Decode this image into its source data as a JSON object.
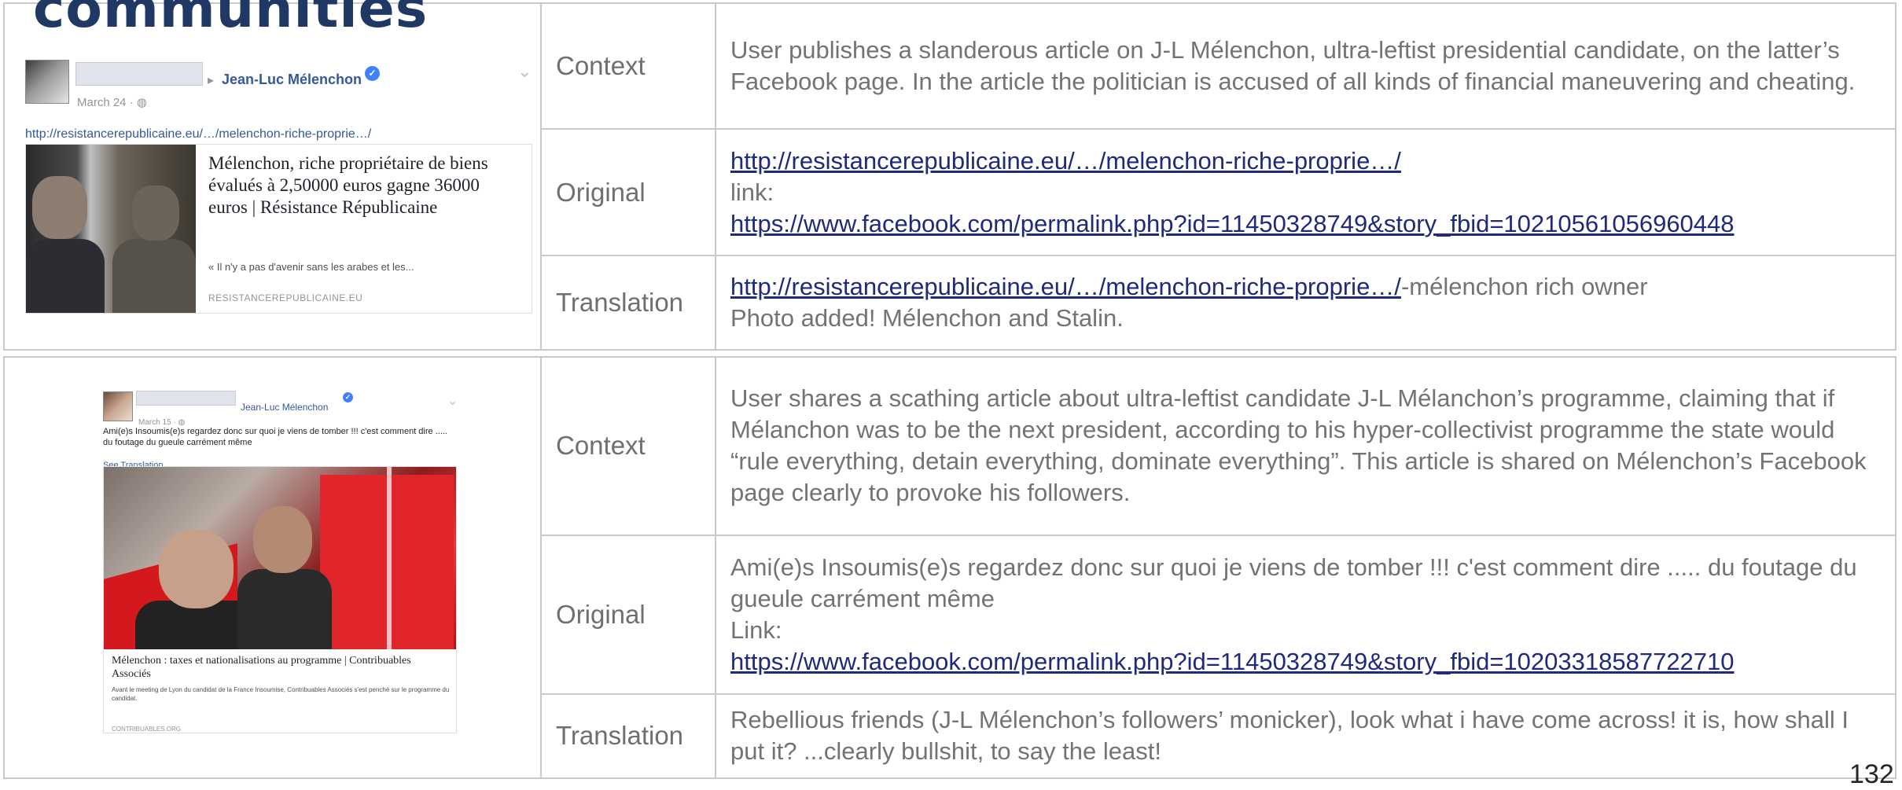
{
  "slide": {
    "heading": "communities",
    "page_number": "132"
  },
  "labels": {
    "context": "Context",
    "original": "Original",
    "translation": "Translation"
  },
  "entry1": {
    "fb": {
      "name": "Jean-Luc Mélenchon",
      "date": "March 24 · ",
      "url": "http://resistancerepublicaine.eu/…/melenchon-riche-proprie…/",
      "card_title": "Mélenchon, riche propriétaire de biens évalués à 2,50000 euros gagne 36000 euros | Résistance Républicaine",
      "card_desc": "« Il n'y a pas d'avenir sans les arabes et les...",
      "card_source": "RESISTANCEREPUBLICAINE.EU"
    },
    "context": "User publishes a slanderous article on J-L Mélenchon, ultra-leftist presidential candidate, on the latter’s Facebook page. In the article the politician is accused of all kinds of financial maneuvering and cheating.",
    "original_link1": "http://resistancerepublicaine.eu/…/melenchon-riche-proprie…/",
    "original_link_label": "link:",
    "original_link2": "https://www.facebook.com/permalink.php?id=11450328749&story_fbid=10210561056960448",
    "translation_link": "http://resistancerepublicaine.eu/…/melenchon-riche-proprie…/",
    "translation_suffix": "-mélenchon rich owner",
    "translation_line2": "Photo added! Mélenchon and Stalin."
  },
  "entry2": {
    "fb": {
      "name": "Jean-Luc Mélenchon",
      "date": "March 15 · ",
      "post_text": "Ami(e)s Insoumis(e)s regardez donc sur quoi je viens de tomber !!! c'est comment dire ..... du foutage du gueule carrément même",
      "see_translation": "See Translation",
      "card_title": "Mélenchon : taxes et nationalisations au programme | Contribuables Associés",
      "card_desc": "Avant le meeting de Lyon du candidat de la France Insoumise, Contribuables Associés s'est penché sur le programme du candidat.",
      "card_source": "CONTRIBUABLES.ORG"
    },
    "context": "User shares a scathing article about ultra-leftist candidate J-L Mélanchon’s programme, claiming that if Mélanchon was to be the next president, according to his hyper-collectivist programme the state would “rule everything, detain everything, dominate everything”. This article is shared on Mélenchon’s Facebook page clearly to provoke his followers.",
    "original_text": "Ami(e)s Insoumis(e)s regardez donc sur quoi je viens de tomber !!! c'est comment dire ..... du foutage du gueule carrément même",
    "original_link_label": "Link:",
    "original_link": "https://www.facebook.com/permalink.php?id=11450328749&story_fbid=10203318587722710",
    "translation": "Rebellious friends (J-L Mélenchon’s followers’ monicker), look what i have come across! it is, how shall I put it? ...clearly bullshit, to say the least!"
  },
  "icons": {
    "verified": "✓",
    "arrow": "▸",
    "chevron": "⌄",
    "globe": "◍"
  }
}
